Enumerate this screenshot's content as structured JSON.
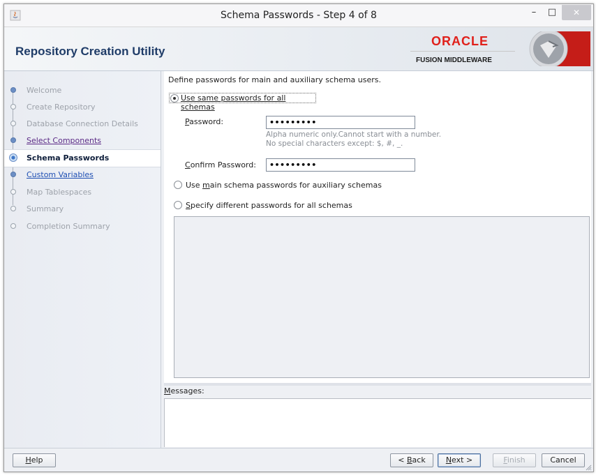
{
  "window": {
    "title": "Schema Passwords - Step 4 of 8",
    "min_glyph": "–",
    "max_glyph": "□",
    "close_glyph": "✕"
  },
  "header": {
    "app_title": "Repository Creation Utility",
    "brand_oracle": "ORACLE",
    "brand_sub": "FUSION MIDDLEWARE"
  },
  "nav": {
    "items": [
      {
        "label": "Welcome",
        "state": "done-muted"
      },
      {
        "label": "Create Repository",
        "state": "done-muted"
      },
      {
        "label": "Database Connection Details",
        "state": "done-muted"
      },
      {
        "label": "Select Components",
        "state": "visited"
      },
      {
        "label": "Schema Passwords",
        "state": "current"
      },
      {
        "label": "Custom Variables",
        "state": "link"
      },
      {
        "label": "Map Tablespaces",
        "state": "pending"
      },
      {
        "label": "Summary",
        "state": "pending"
      },
      {
        "label": "Completion Summary",
        "state": "pending"
      }
    ]
  },
  "main": {
    "intro": "Define passwords for main and auxiliary schema users.",
    "option_same": "Use same passwords for all schemas",
    "password_label": "Password:",
    "password_value": "•••••••••",
    "hint_line1": "Alpha numeric only.Cannot start with a number.",
    "hint_line2": "No special characters except: $, #, _.",
    "confirm_label": "Confirm Password:",
    "confirm_value": "•••••••••",
    "option_main": "Use main schema passwords for auxiliary schemas",
    "option_different": "Specify different passwords for all schemas",
    "selected_option": "same"
  },
  "messages": {
    "label": "Messages:"
  },
  "footer": {
    "help": "Help",
    "back": "< Back",
    "next": "Next >",
    "finish": "Finish",
    "cancel": "Cancel"
  },
  "colors": {
    "brand_red": "#e0201b",
    "title_blue": "#1f3c68",
    "link_blue": "#1f4fb3",
    "visited_purple": "#5b2a86"
  }
}
